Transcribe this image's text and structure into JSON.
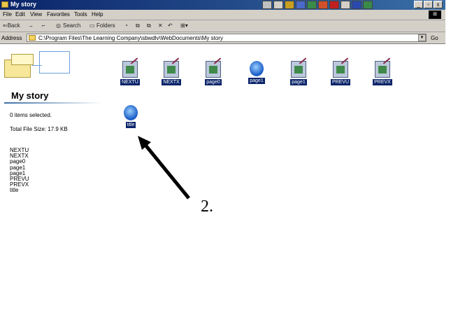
{
  "window": {
    "title": "My story",
    "min": "_",
    "max": "▫",
    "close": "x"
  },
  "menu": [
    "File",
    "Edit",
    "View",
    "Favorites",
    "Tools",
    "Help"
  ],
  "toolbar": {
    "back": "⇐Back",
    "forward": "→",
    "up": "⌐",
    "search": "Search",
    "folders": "Folders",
    "views": "⊞▾"
  },
  "address": {
    "label": "Address",
    "path": "C:\\Program Files\\The Learning Company\\sbwdlv\\WebDocuments\\My story",
    "go": "Go"
  },
  "left": {
    "title": "My story",
    "selected": "0 items selected.",
    "total": "Total File Size: 17.9 KB",
    "files": [
      "NEXTU",
      "NEXTX",
      "page0",
      "page1",
      "page1",
      "PREVU",
      "PREVX",
      "title"
    ]
  },
  "icons": [
    {
      "label": "NEXTU",
      "icon": "image-doc-icon"
    },
    {
      "label": "NEXTX",
      "icon": "image-doc-icon"
    },
    {
      "label": "page0",
      "icon": "image-doc-icon"
    },
    {
      "label": "page1",
      "icon": "ie-doc-icon"
    },
    {
      "label": "page1",
      "icon": "image-doc-icon"
    },
    {
      "label": "PREVU",
      "icon": "image-doc-icon"
    },
    {
      "label": "PREVX",
      "icon": "image-doc-icon"
    },
    {
      "label": "title",
      "icon": "ie-doc-icon"
    }
  ],
  "annotation": {
    "label": "2."
  },
  "colors": {
    "titlebar": "#0a246a",
    "chrome": "#d4d0c8",
    "selection": "#0a246a"
  }
}
